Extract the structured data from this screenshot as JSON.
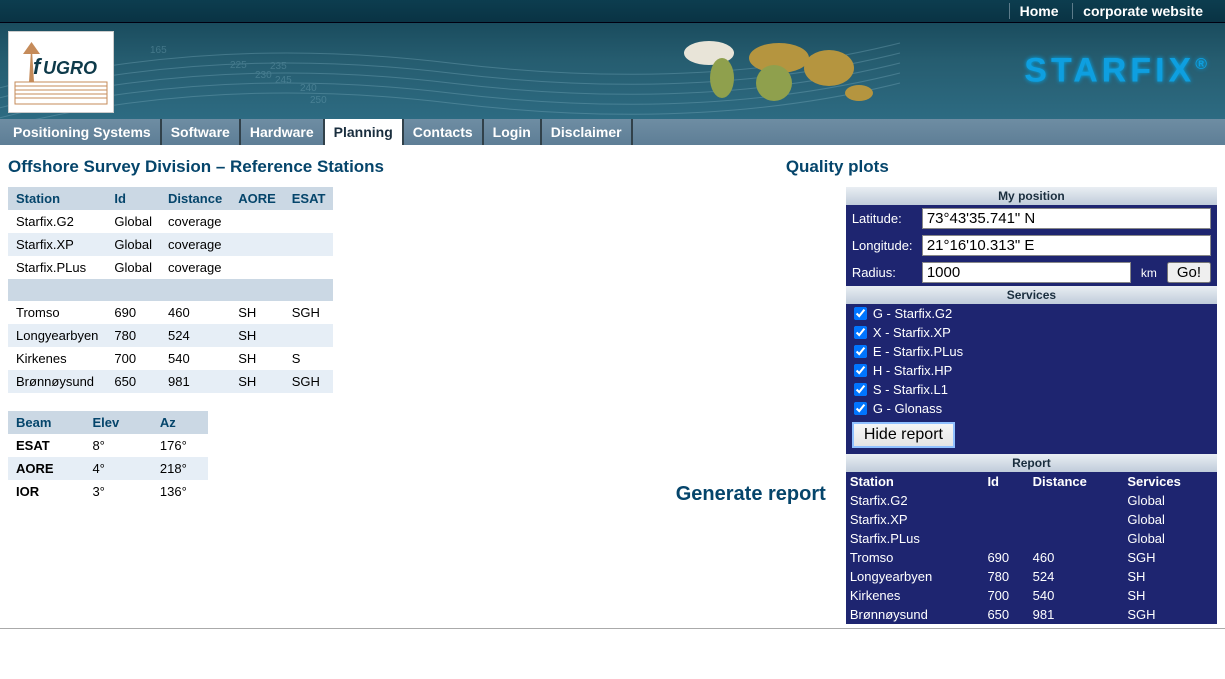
{
  "topbar": {
    "home": "Home",
    "corp": "corporate website"
  },
  "brand": {
    "logo": "FUGRO",
    "product": "STARFIX",
    "reg": "®"
  },
  "nav": {
    "items": [
      "Positioning Systems",
      "Software",
      "Hardware",
      "Planning",
      "Contacts",
      "Login",
      "Disclaimer"
    ],
    "active": 3
  },
  "left": {
    "title": "Offshore Survey Division – Reference Stations",
    "stationsHeaders": [
      "Station",
      "Id",
      "Distance",
      "AORE",
      "ESAT"
    ],
    "stations": [
      {
        "station": "Starfix.G2",
        "id": "Global",
        "dist": "coverage",
        "aore": "",
        "esat": ""
      },
      {
        "station": "Starfix.XP",
        "id": "Global",
        "dist": "coverage",
        "aore": "",
        "esat": ""
      },
      {
        "station": "Starfix.PLus",
        "id": "Global",
        "dist": "coverage",
        "aore": "",
        "esat": ""
      }
    ],
    "stations2": [
      {
        "station": "Tromso",
        "id": "690",
        "dist": "460",
        "aore": "SH",
        "esat": "SGH"
      },
      {
        "station": "Longyearbyen",
        "id": "780",
        "dist": "524",
        "aore": "SH",
        "esat": ""
      },
      {
        "station": "Kirkenes",
        "id": "700",
        "dist": "540",
        "aore": "SH",
        "esat": "S"
      },
      {
        "station": "Brønnøysund",
        "id": "650",
        "dist": "981",
        "aore": "SH",
        "esat": "SGH"
      }
    ],
    "beamsHeaders": [
      "Beam",
      "Elev",
      "Az"
    ],
    "beams": [
      {
        "beam": "ESAT",
        "elev": "8°",
        "az": "176°"
      },
      {
        "beam": "AORE",
        "elev": "4°",
        "az": "218°"
      },
      {
        "beam": "IOR",
        "elev": "3°",
        "az": "136°"
      }
    ]
  },
  "right": {
    "quality": "Quality plots",
    "mypos": {
      "title": "My position",
      "latL": "Latitude:",
      "lat": "73°43'35.741\" N",
      "lonL": "Longitude:",
      "lon": "21°16'10.313\" E",
      "radL": "Radius:",
      "rad": "1000",
      "unit": "km",
      "go": "Go!"
    },
    "services": {
      "title": "Services",
      "items": [
        {
          "id": "g2",
          "label": "G - Starfix.G2",
          "checked": true
        },
        {
          "id": "xp",
          "label": "X - Starfix.XP",
          "checked": true
        },
        {
          "id": "plus",
          "label": "E - Starfix.PLus",
          "checked": true
        },
        {
          "id": "hp",
          "label": "H - Starfix.HP",
          "checked": true
        },
        {
          "id": "l1",
          "label": "S - Starfix.L1",
          "checked": true
        },
        {
          "id": "glo",
          "label": "G - Glonass",
          "checked": true
        }
      ],
      "hide": "Hide report"
    },
    "report": {
      "title": "Report",
      "headers": [
        "Station",
        "Id",
        "Distance",
        "Services"
      ],
      "rows": [
        {
          "station": "Starfix.G2",
          "id": "",
          "dist": "",
          "svc": "Global"
        },
        {
          "station": "Starfix.XP",
          "id": "",
          "dist": "",
          "svc": "Global"
        },
        {
          "station": "Starfix.PLus",
          "id": "",
          "dist": "",
          "svc": "Global"
        },
        {
          "station": "Tromso",
          "id": "690",
          "dist": "460",
          "svc": "SGH"
        },
        {
          "station": "Longyearbyen",
          "id": "780",
          "dist": "524",
          "svc": "SH"
        },
        {
          "station": "Kirkenes",
          "id": "700",
          "dist": "540",
          "svc": "SH"
        },
        {
          "station": "Brønnøysund",
          "id": "650",
          "dist": "981",
          "svc": "SGH"
        }
      ]
    }
  },
  "generate": "Generate report"
}
